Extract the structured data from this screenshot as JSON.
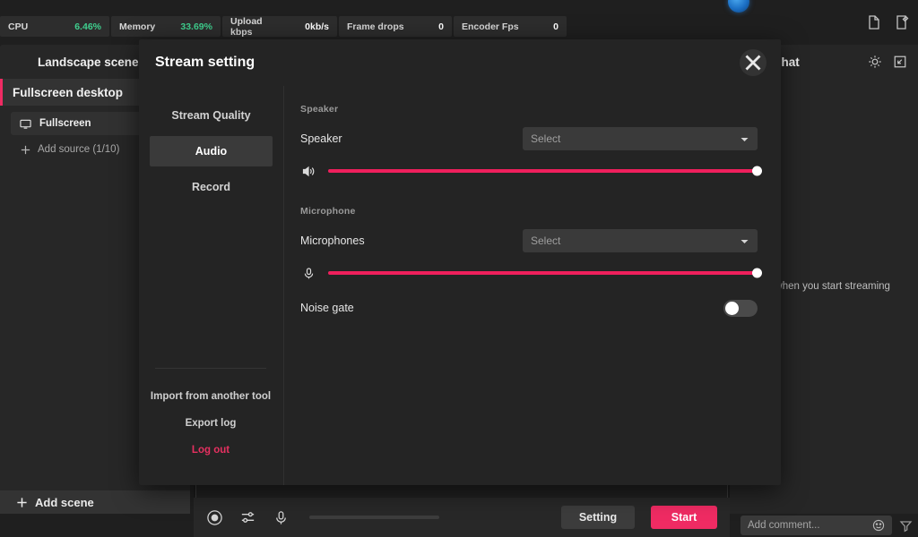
{
  "statusbar": {
    "items": [
      {
        "key": "CPU",
        "value": "6.46%",
        "tone": "green"
      },
      {
        "key": "Memory",
        "value": "33.69%",
        "tone": "green"
      },
      {
        "key": "Upload kbps",
        "value": "0kb/s",
        "tone": "white"
      },
      {
        "key": "Frame drops",
        "value": "0",
        "tone": "white"
      },
      {
        "key": "Encoder Fps",
        "value": "0",
        "tone": "white"
      }
    ]
  },
  "top_icons": [
    {
      "name": "document-icon"
    },
    {
      "name": "edit-note-icon"
    }
  ],
  "scene_panel": {
    "title": "Landscape scenes",
    "scene": "Fullscreen desktop",
    "source": "Fullscreen",
    "add_source": "Add source (1/10)",
    "add_scene": "Add scene"
  },
  "chat_panel": {
    "title": "LIVE Chat",
    "note": "shown when you start streaming",
    "comment_placeholder": "Add comment..."
  },
  "bottombar": {
    "setting_label": "Setting",
    "start_label": "Start"
  },
  "modal": {
    "title": "Stream setting",
    "nav": [
      {
        "label": "Stream Quality",
        "active": false
      },
      {
        "label": "Audio",
        "active": true
      },
      {
        "label": "Record",
        "active": false
      }
    ],
    "nav_links": [
      {
        "label": "Import from another tool",
        "danger": false
      },
      {
        "label": "Export log",
        "danger": false
      },
      {
        "label": "Log out",
        "danger": true
      }
    ],
    "speaker": {
      "group_label": "Speaker",
      "row_label": "Speaker",
      "select_value": "Select",
      "volume_percent": 100
    },
    "microphone": {
      "group_label": "Microphone",
      "row_label": "Microphones",
      "select_value": "Select",
      "volume_percent": 100,
      "noise_gate_label": "Noise gate",
      "noise_gate_on": false
    }
  },
  "colors": {
    "accent_pink": "#ef2b63",
    "slider_pink": "#ef1f5c",
    "status_green": "#3fcf8e",
    "logout_red": "#e53060"
  }
}
